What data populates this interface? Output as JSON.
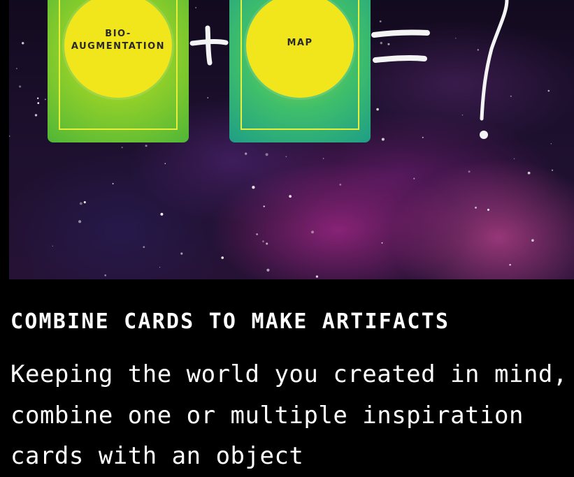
{
  "hero": {
    "cards": [
      {
        "label_line1": "BIO-",
        "label_line2": "AUGMENTATION"
      },
      {
        "label": "MAP"
      }
    ],
    "operator_plus": "+",
    "operator_equals": "=",
    "result": "?"
  },
  "section": {
    "heading": "COMBINE CARDS TO MAKE ARTIFACTS",
    "body": "Keeping the world you created in mind, combine one or multiple inspiration cards with an object"
  },
  "colors": {
    "background": "#000000",
    "text": "#ffffff",
    "card_yellow": "#f1e51b",
    "card_green": "#4fb637",
    "card_teal": "#1e9e86"
  }
}
